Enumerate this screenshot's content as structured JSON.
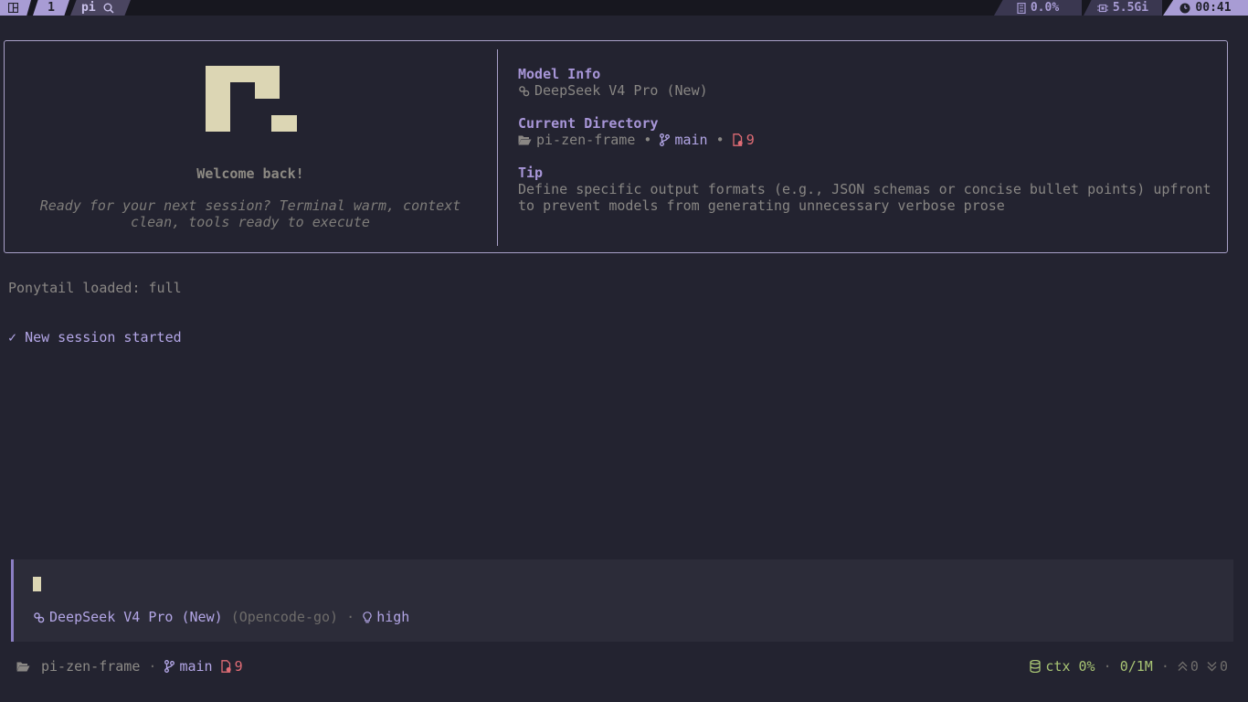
{
  "topbar": {
    "window_index": "1",
    "window_name": "pi",
    "cpu": "0.0%",
    "memory": "5.5Gi",
    "time": "00:41"
  },
  "welcome": {
    "title": "Welcome back!",
    "tagline_line1": "Ready for your next session? Terminal warm, context",
    "tagline_line2": "clean, tools ready to execute"
  },
  "info": {
    "model_heading": "Model Info",
    "model_name": "DeepSeek V4 Pro (New)",
    "dir_heading": "Current Directory",
    "dir_name": "pi-zen-frame",
    "sep": "•",
    "branch": "main",
    "changes": "9",
    "tip_heading": "Tip",
    "tip_line1": "Define specific output formats (e.g., JSON schemas or concise bullet points) upfront",
    "tip_line2": "to prevent models from generating unnecessary verbose prose"
  },
  "log": {
    "ponytail": "Ponytail loaded: full",
    "session_check": "✓",
    "session_text": "New session started"
  },
  "input": {
    "model_name": "DeepSeek V4 Pro (New)",
    "provider": "(Opencode-go)",
    "sep": "·",
    "thinking": "high"
  },
  "status": {
    "dir_name": "pi-zen-frame",
    "sep": "·",
    "branch": "main",
    "changes": "9",
    "ctx": "ctx 0%",
    "tokens": "0/1M",
    "up_count": "0",
    "down_count": "0"
  },
  "colors": {
    "background": "#232330",
    "accent": "#a896d8",
    "logo": "#dcd6b4",
    "red": "#e06c75",
    "green": "#a8c474"
  }
}
